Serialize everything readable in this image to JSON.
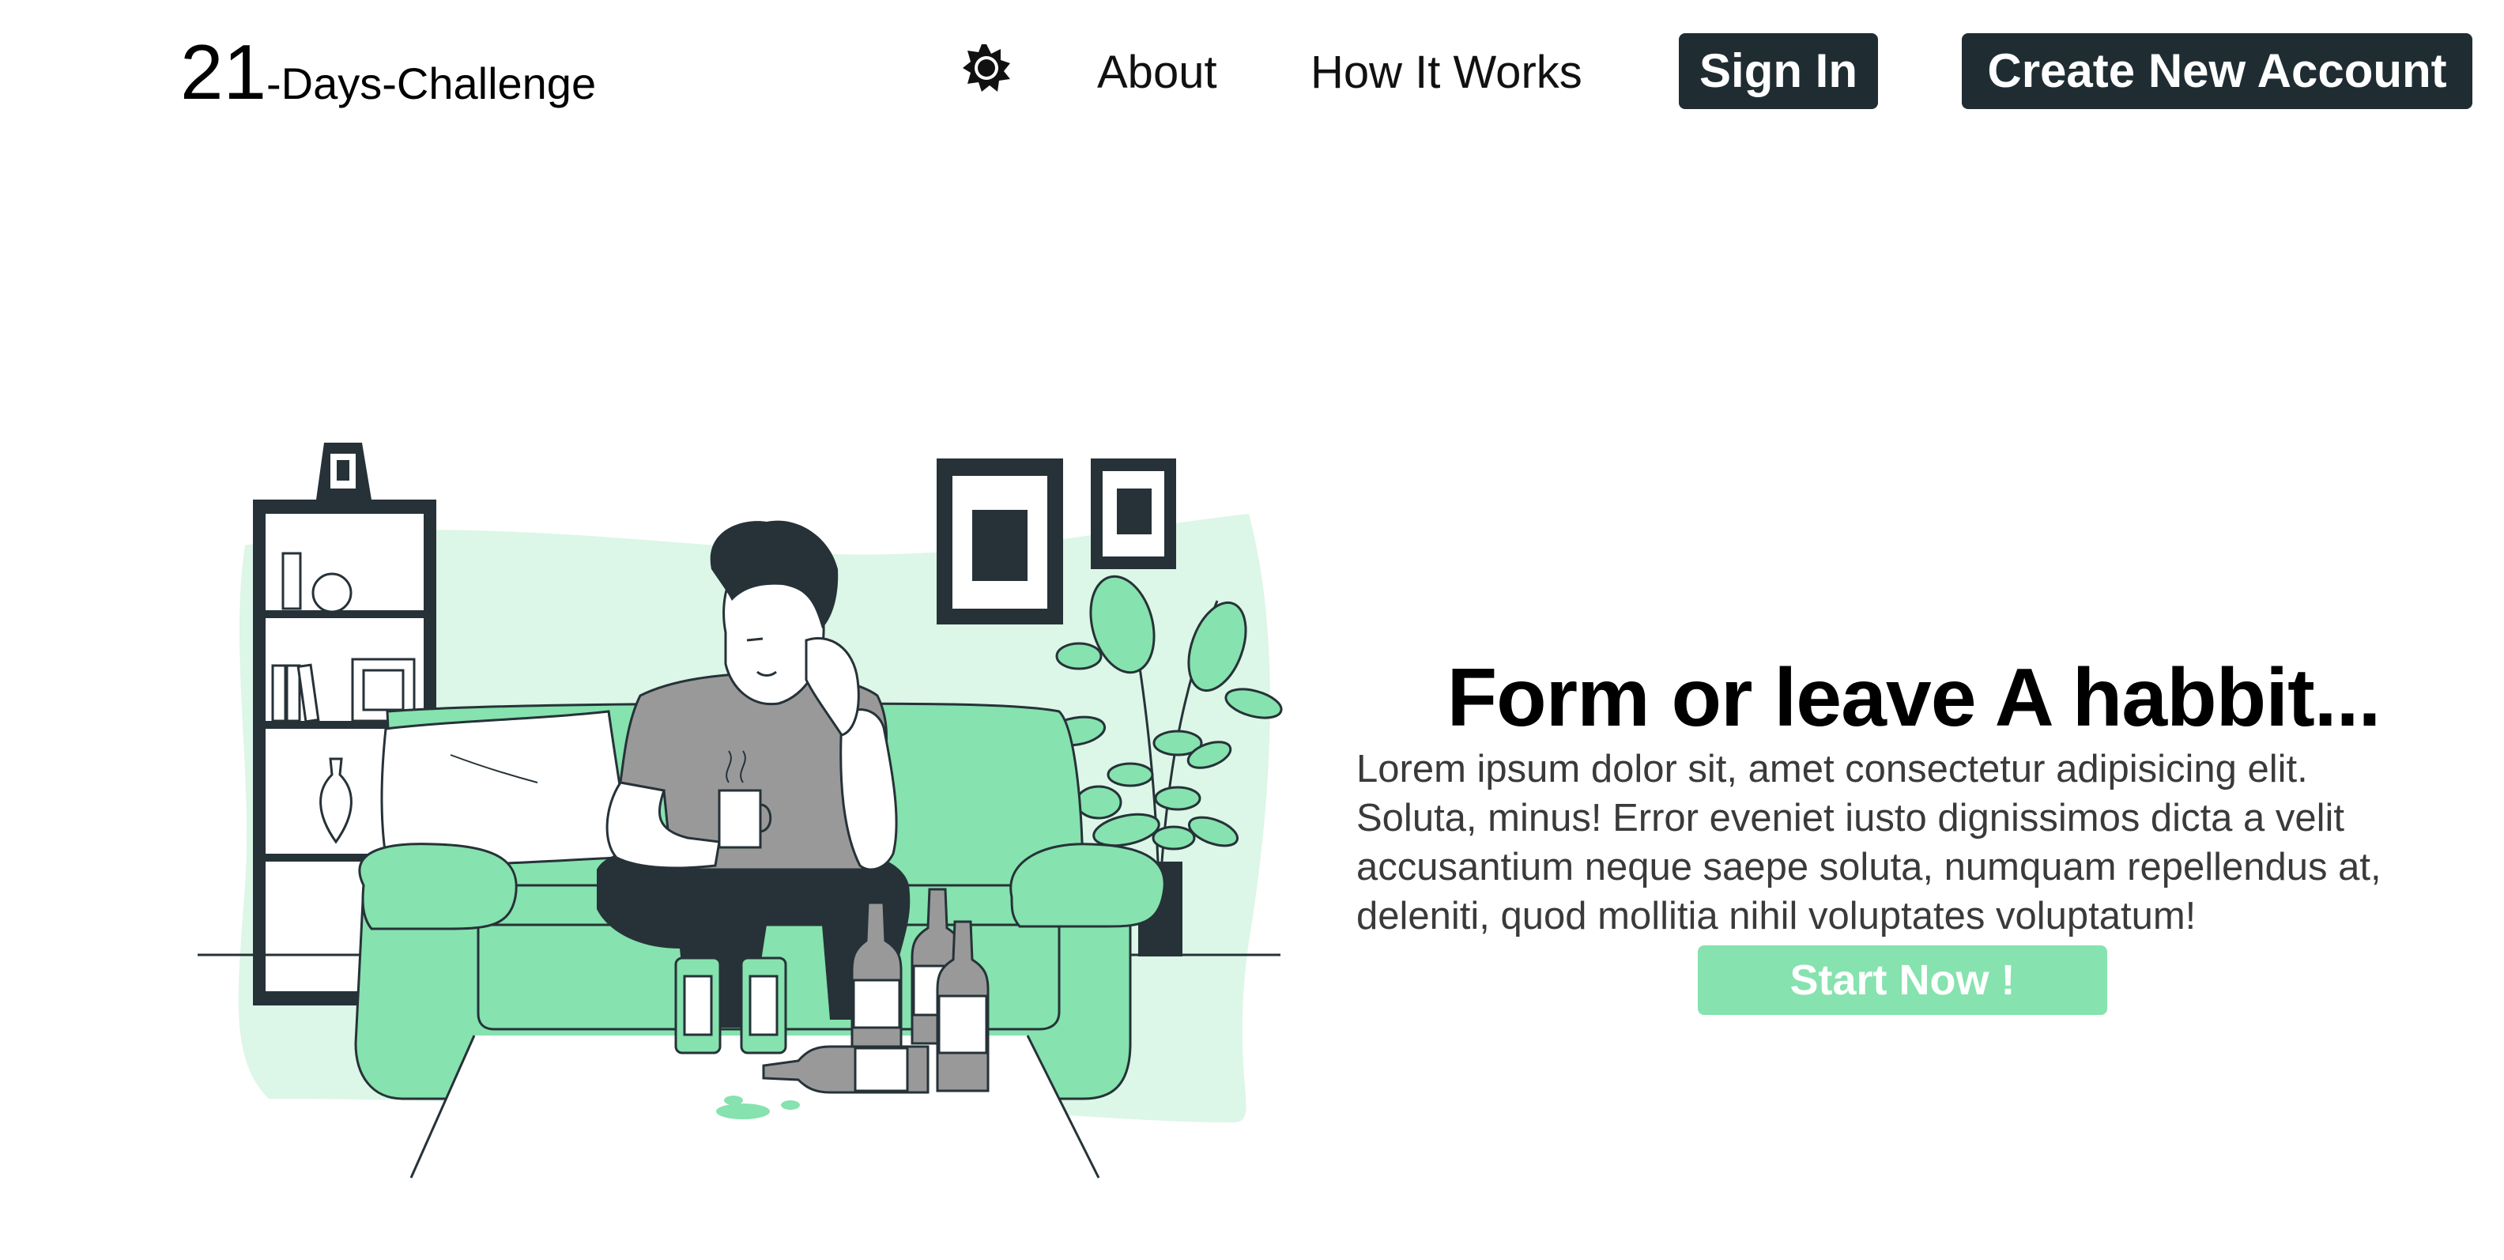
{
  "navbar": {
    "logo_number": "21",
    "logo_text": "-Days-Challenge",
    "theme_toggle_icon": "sun-icon",
    "links": {
      "about": "About",
      "how_it_works": "How It Works"
    },
    "sign_in_label": "Sign In",
    "create_account_label": "Create New Account"
  },
  "hero": {
    "illustration": "man-on-couch-with-bottles-illustration",
    "title": "Form or leave A habbit...",
    "description": "Lorem ipsum dolor sit, amet consectetur adipisicing elit. Soluta, minus! Error eveniet iusto dignissimos dicta a velit accusantium neque saepe soluta, numquam repellendus at, deleniti, quod mollitia nihil voluptates voluptatum!",
    "cta_label": "Start Now !"
  },
  "colors": {
    "dark_button": "#1f2d33",
    "accent_green": "#86e2ae",
    "light_green": "#dcf6e7",
    "illustration_dark": "#263238"
  }
}
